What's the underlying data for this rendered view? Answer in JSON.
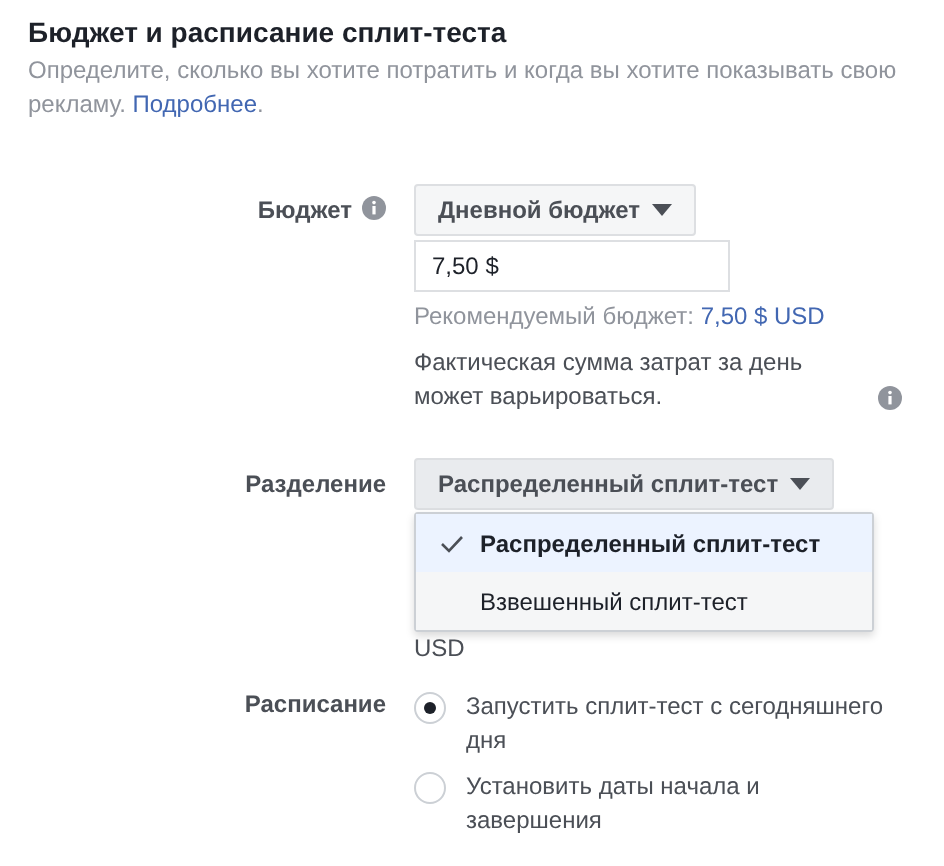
{
  "section": {
    "title": "Бюджет и расписание сплит-теста",
    "description": "Определите, сколько вы хотите потратить и когда вы хотите показывать свою рекламу.",
    "learn_more": "Подробнее",
    "after_link": "."
  },
  "budget": {
    "label": "Бюджет",
    "type_button": "Дневной бюджет",
    "amount": "7,50 $",
    "recommended_label": "Рекомендуемый бюджет:",
    "recommended_value": "7,50 $ USD",
    "note": "Фактическая сумма затрат за день может варьироваться."
  },
  "split": {
    "label": "Разделение",
    "button": "Распределенный сплит-тест",
    "options": [
      {
        "label": "Распределенный сплит-тест",
        "selected": true
      },
      {
        "label": "Взвешенный сплит-тест",
        "selected": false
      }
    ],
    "below_text": "USD"
  },
  "schedule": {
    "label": "Расписание",
    "options": [
      {
        "label": "Запустить сплит-тест с сегодняшнего дня",
        "selected": true
      },
      {
        "label": "Установить даты начала и завершения",
        "selected": false
      }
    ]
  }
}
